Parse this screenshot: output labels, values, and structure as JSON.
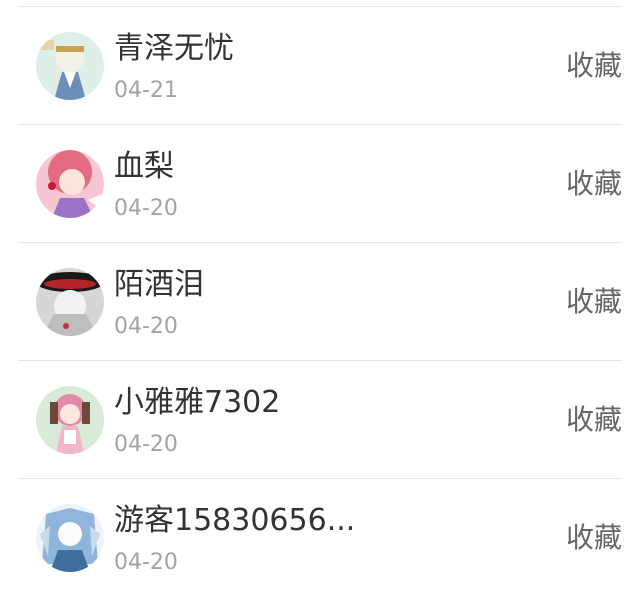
{
  "list": {
    "items": [
      {
        "name": "青泽无忧",
        "date": "04-21",
        "action": "收藏",
        "avatar_icon": "anime-avatar-light"
      },
      {
        "name": "血梨",
        "date": "04-20",
        "action": "收藏",
        "avatar_icon": "anime-avatar-pink"
      },
      {
        "name": "陌酒泪",
        "date": "04-20",
        "action": "收藏",
        "avatar_icon": "anime-avatar-red-hat"
      },
      {
        "name": "小雅雅7302",
        "date": "04-20",
        "action": "收藏",
        "avatar_icon": "anime-avatar-doll"
      },
      {
        "name": "游客15830656...",
        "date": "04-20",
        "action": "收藏",
        "avatar_icon": "anime-avatar-blue-hair"
      }
    ]
  },
  "colors": {
    "name_text": "#333333",
    "date_text": "#a3a3a3",
    "action_text": "#666666",
    "divider": "#e6e6e6"
  }
}
